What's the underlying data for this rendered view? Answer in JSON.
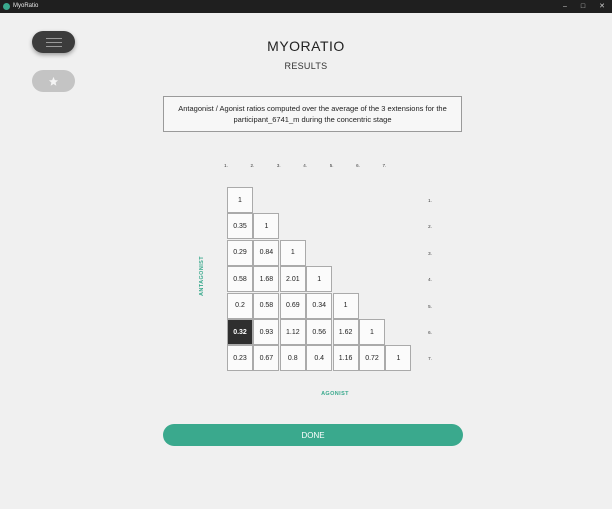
{
  "window": {
    "title": "MyoRatio",
    "controls": [
      "–",
      "□",
      "✕"
    ]
  },
  "colors": {
    "accent": "#3aa98d",
    "selected_cell": "#2f2f2f",
    "titlebar": "#1f1f1f"
  },
  "sidebar": {
    "menu_icon": "hamburger-icon",
    "star_icon": "star-icon"
  },
  "header": {
    "title": "MYORATIO",
    "subtitle": "RESULTS"
  },
  "info": {
    "text": "Antagonist / Agonist ratios computed over the average of the 3 extensions for the participant_6741_m during the concentric stage"
  },
  "matrix": {
    "column_labels": [
      "1.",
      "2.",
      "3.",
      "4.",
      "5.",
      "6.",
      "7."
    ],
    "row_labels": [
      "1.",
      "2.",
      "3.",
      "4.",
      "5.",
      "6.",
      "7."
    ],
    "rows": [
      [
        "1"
      ],
      [
        "0.35",
        "1"
      ],
      [
        "0.29",
        "0.84",
        "1"
      ],
      [
        "0.58",
        "1.68",
        "2.01",
        "1"
      ],
      [
        "0.2",
        "0.58",
        "0.69",
        "0.34",
        "1"
      ],
      [
        "0.32",
        "0.93",
        "1.12",
        "0.56",
        "1.62",
        "1"
      ],
      [
        "0.23",
        "0.67",
        "0.8",
        "0.4",
        "1.16",
        "0.72",
        "1"
      ]
    ],
    "selected": {
      "row": 5,
      "col": 0
    },
    "y_axis_label": "ANTAGONIST",
    "x_axis_label": "AGONIST"
  },
  "actions": {
    "done_label": "DONE"
  }
}
